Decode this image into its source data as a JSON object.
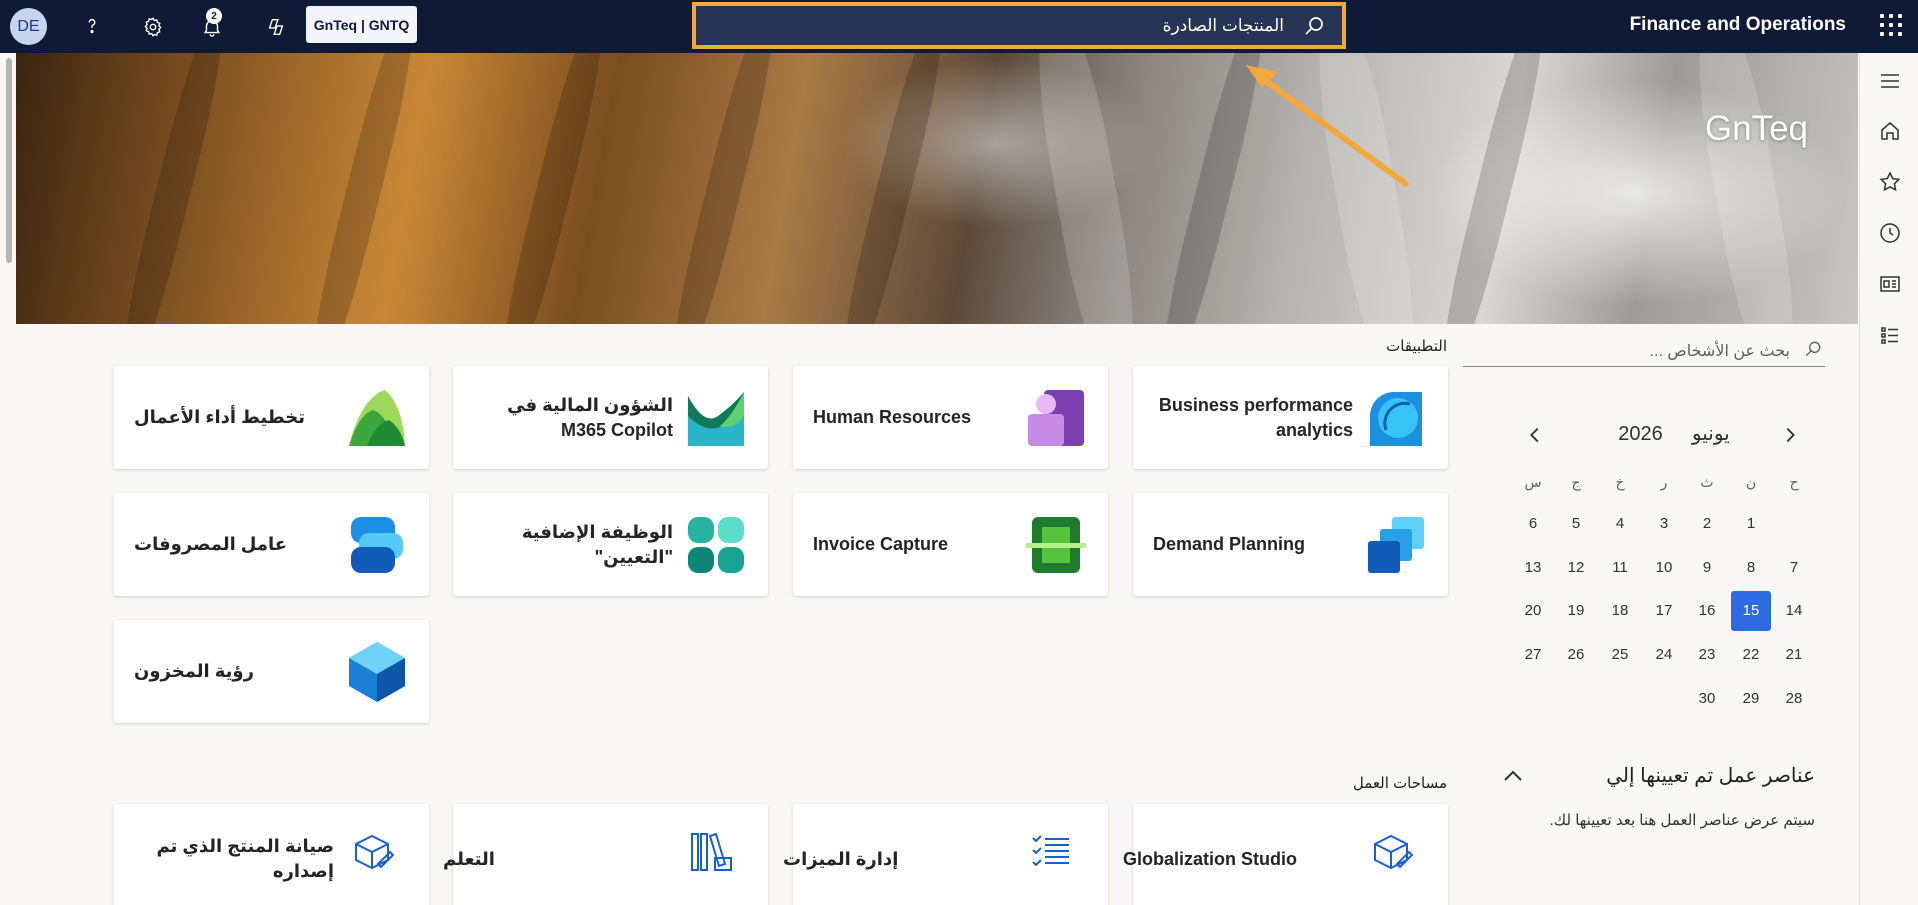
{
  "topbar": {
    "avatar_initials": "DE",
    "notification_count": "2",
    "company": "GnTeq | GNTQ",
    "search_value": "المنتجات الصادرة",
    "app_title": "Finance and Operations"
  },
  "banner": {
    "title": "GnTeq"
  },
  "people_search": {
    "placeholder": "بحث عن الأشخاص ..."
  },
  "calendar": {
    "month": "يونيو",
    "year": "2026",
    "weekdays": [
      "ح",
      "ن",
      "ث",
      "ر",
      "خ",
      "ج",
      "س"
    ],
    "selected_day": "15",
    "weeks": [
      [
        "",
        "1",
        "2",
        "3",
        "4",
        "5",
        "6"
      ],
      [
        "7",
        "8",
        "9",
        "10",
        "11",
        "12",
        "13"
      ],
      [
        "14",
        "15",
        "16",
        "17",
        "18",
        "19",
        "20"
      ],
      [
        "21",
        "22",
        "23",
        "24",
        "25",
        "26",
        "27"
      ],
      [
        "28",
        "29",
        "30",
        "",
        "",
        "",
        ""
      ]
    ]
  },
  "work_items": {
    "title": "عناصر عمل تم تعيينها إلي",
    "description": "سيتم عرض عناصر العمل هنا بعد تعيينها لك."
  },
  "apps": {
    "heading": "التطبيقات",
    "tiles": [
      {
        "label": "Business performance analytics",
        "icon": "business-performance-analytics-icon"
      },
      {
        "label": "Human Resources",
        "icon": "human-resources-icon"
      },
      {
        "label": "الشؤون المالية في M365 Copilot",
        "icon": "m365-copilot-finance-icon"
      },
      {
        "label": "تخطيط أداء الأعمال",
        "icon": "business-performance-planning-icon"
      },
      {
        "label": "Demand Planning",
        "icon": "demand-planning-icon"
      },
      {
        "label": "Invoice Capture",
        "icon": "invoice-capture-icon"
      },
      {
        "label": "الوظيفة الإضافية \"التعيين\"",
        "icon": "assignment-addin-icon"
      },
      {
        "label": "عامل المصروفات",
        "icon": "expense-agent-icon"
      },
      {
        "label": "رؤية المخزون",
        "icon": "inventory-visibility-icon"
      }
    ]
  },
  "workspaces": {
    "heading": "مساحات العمل",
    "tiles": [
      {
        "label": "Globalization Studio",
        "icon": "globalization-studio-icon"
      },
      {
        "label": "إدارة الميزات",
        "icon": "feature-management-icon"
      },
      {
        "label": "التعلم",
        "icon": "learning-icon"
      },
      {
        "label": "صيانة المنتج الذي تم إصداره",
        "icon": "released-product-maintenance-icon"
      }
    ]
  },
  "colors": {
    "topbar": "#0f1b36",
    "search_highlight": "#f2a83b",
    "accent": "#2e6be0",
    "annotation_arrow": "#f2a83b"
  }
}
